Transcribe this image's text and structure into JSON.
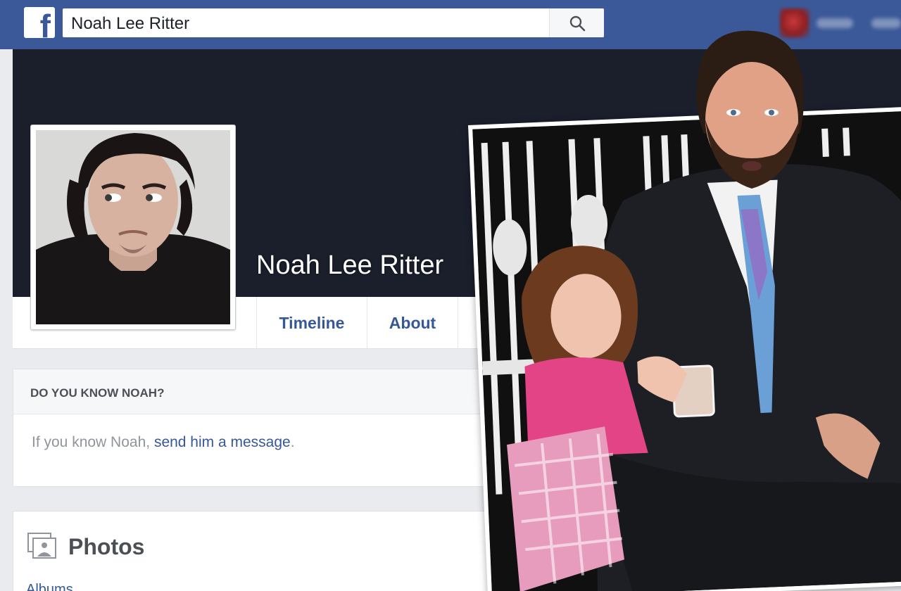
{
  "search": {
    "value": "Noah Lee Ritter"
  },
  "profile": {
    "name": "Noah Lee Ritter"
  },
  "tabs": [
    {
      "label": "Timeline"
    },
    {
      "label": "About"
    }
  ],
  "know_card": {
    "heading": "DO YOU KNOW NOAH?",
    "text_prefix": "If you know Noah, ",
    "link": "send him a message",
    "text_suffix": "."
  },
  "photos_card": {
    "title": "Photos",
    "albums_label": "Albums"
  },
  "icons": [
    "facebook-logo-icon",
    "search-icon",
    "photos-icon"
  ],
  "colors": {
    "brand": "#3b5998",
    "link": "#365899",
    "cover": "#1b1f2c",
    "background": "#e9ebee"
  }
}
